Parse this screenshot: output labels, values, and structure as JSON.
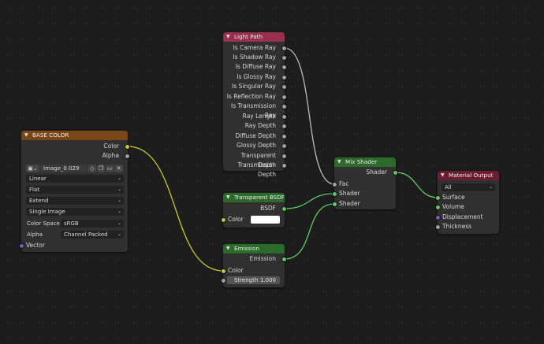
{
  "colors": {
    "canvas": "#1d1d1d",
    "node_body": "#303030",
    "header_input": "#7a4517",
    "header_input_name": "#9a2f4f",
    "header_shader": "#2b6a2b",
    "header_output": "#6b1e2d",
    "socket_gray": "#a1a1a1",
    "socket_yellow": "#c7c729",
    "socket_green": "#63c763",
    "socket_purple": "#6363c7",
    "wire_gray": "#bdbdbd",
    "wire_yellow": "#c7c729",
    "wire_green": "#63c763"
  },
  "image_node": {
    "title": "BASE COLOR",
    "outputs": [
      "Color",
      "Alpha"
    ],
    "image_name": "Image_0.029",
    "interpolation": "Linear",
    "projection": "Flat",
    "extension": "Extend",
    "source": "Single Image",
    "color_space_label": "Color Space",
    "color_space": "sRGB",
    "alpha_label": "Alpha",
    "alpha": "Channel Packed",
    "input": "Vector"
  },
  "light_path": {
    "title": "Light Path",
    "outputs": [
      "Is Camera Ray",
      "Is Shadow Ray",
      "Is Diffuse Ray",
      "Is Glossy Ray",
      "Is Singular Ray",
      "Is Reflection Ray",
      "Is Transmission Ray",
      "Ray Length",
      "Ray Depth",
      "Diffuse Depth",
      "Glossy Depth",
      "Transparent Depth",
      "Transmission Depth"
    ]
  },
  "transparent": {
    "title": "Transparent BSDF",
    "output": "BSDF",
    "input": "Color",
    "color_value": "#ffffff"
  },
  "emission": {
    "title": "Emission",
    "output": "Emission",
    "input": "Color",
    "strength_label": "Strength",
    "strength_value": "1.000"
  },
  "mix": {
    "title": "Mix Shader",
    "output": "Shader",
    "inputs": [
      "Fac",
      "Shader",
      "Shader"
    ]
  },
  "material_output": {
    "title": "Material Output",
    "target": "All",
    "inputs": [
      "Surface",
      "Volume",
      "Displacement",
      "Thickness"
    ]
  }
}
